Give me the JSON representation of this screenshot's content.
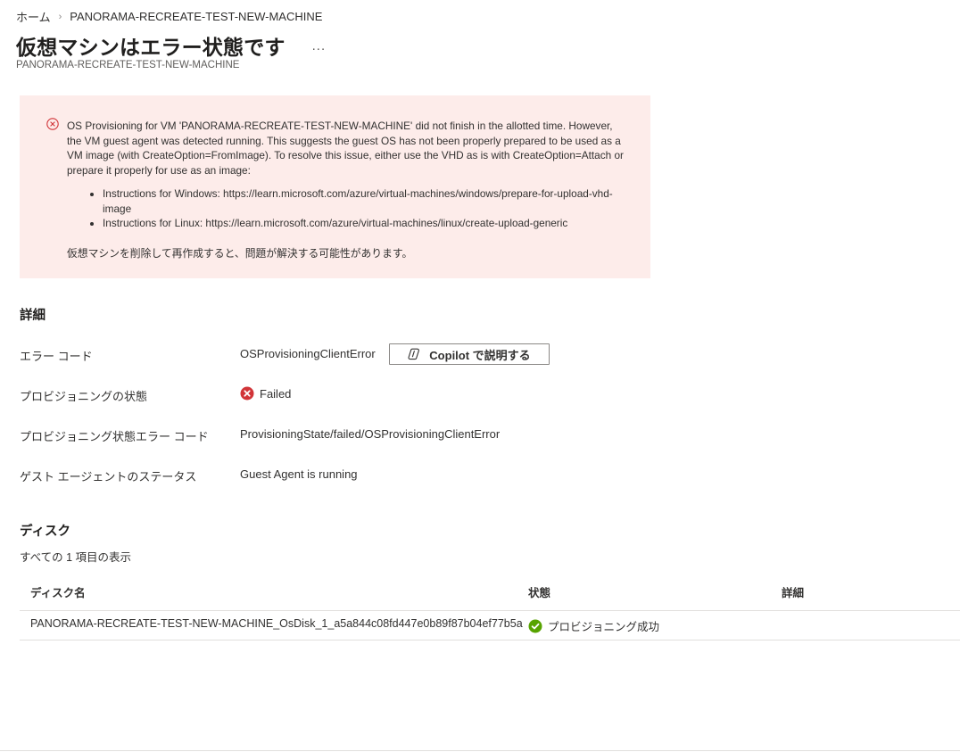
{
  "breadcrumb": {
    "home": "ホーム",
    "current": "PANORAMA-RECREATE-TEST-NEW-MACHINE"
  },
  "header": {
    "title": "仮想マシンはエラー状態です",
    "more": "...",
    "subtitle": "PANORAMA-RECREATE-TEST-NEW-MACHINE"
  },
  "alert": {
    "message": "OS Provisioning for VM 'PANORAMA-RECREATE-TEST-NEW-MACHINE' did not finish in the allotted time. However, the VM guest agent was detected running. This suggests the guest OS has not been properly prepared to be used as a VM image (with CreateOption=FromImage). To resolve this issue, either use the VHD as is with CreateOption=Attach or prepare it properly for use as an image:",
    "bullets": [
      "Instructions for Windows: https://learn.microsoft.com/azure/virtual-machines/windows/prepare-for-upload-vhd-image",
      "Instructions for Linux: https://learn.microsoft.com/azure/virtual-machines/linux/create-upload-generic"
    ],
    "note": "仮想マシンを削除して再作成すると、問題が解決する可能性があります。"
  },
  "details": {
    "title": "詳細",
    "rows": [
      {
        "label": "エラー コード",
        "value": "OSProvisioningClientError"
      },
      {
        "label": "プロビジョニングの状態",
        "value": "Failed"
      },
      {
        "label": "プロビジョニング状態エラー コード",
        "value": "ProvisioningState/failed/OSProvisioningClientError"
      },
      {
        "label": "ゲスト エージェントのステータス",
        "value": "Guest Agent is running"
      }
    ],
    "copilot_label": "Copilot で説明する"
  },
  "disks": {
    "title": "ディスク",
    "count_text": "すべての 1 項目の表示",
    "columns": [
      "ディスク名",
      "状態",
      "詳細"
    ],
    "rows": [
      {
        "name": "PANORAMA-RECREATE-TEST-NEW-MACHINE_OsDisk_1_a5a844c08fd447e0b89f87b04ef77b5a",
        "status": "プロビジョニング成功",
        "detail": ""
      }
    ]
  },
  "colors": {
    "error": "#d13438",
    "success": "#57a300",
    "alert_bg": "#fdecea"
  },
  "icons": {
    "alert": "error-circle-icon",
    "failed": "failed-status-icon",
    "success": "success-check-icon",
    "copilot": "copilot-icon"
  }
}
